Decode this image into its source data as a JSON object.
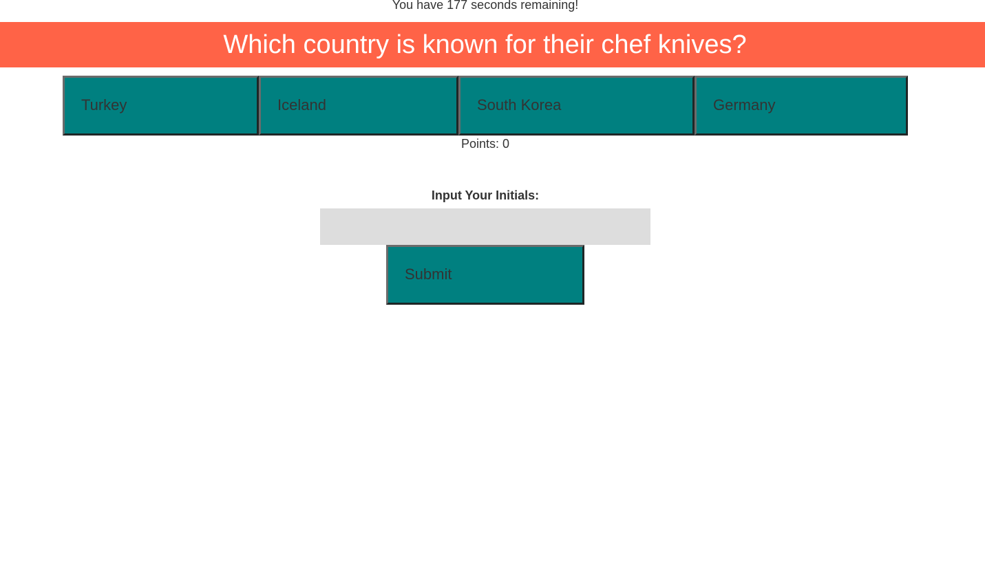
{
  "quiz": {
    "timer_text": "You have 177 seconds remaining!",
    "question": "Which country is known for their chef knives?",
    "answers": [
      {
        "label": "Turkey"
      },
      {
        "label": "Iceland"
      },
      {
        "label": "South Korea"
      },
      {
        "label": "Germany"
      }
    ],
    "points_text": "Points: 0"
  },
  "score_form": {
    "label": "Input Your Initials:",
    "input_value": "",
    "submit_label": "Submit"
  },
  "colors": {
    "banner": "#ff6347",
    "button": "#008080",
    "input_bg": "#dddddd"
  }
}
